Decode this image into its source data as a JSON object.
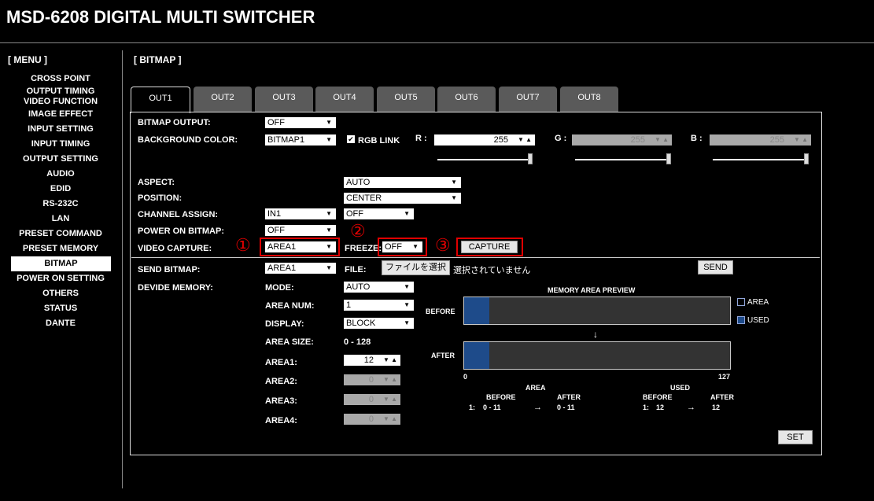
{
  "app_title": "MSD-6208 DIGITAL MULTI SWITCHER",
  "menu": {
    "heading": "[ MENU ]",
    "items": [
      "CROSS POINT",
      "OUTPUT TIMING",
      "VIDEO FUNCTION",
      "IMAGE EFFECT",
      "INPUT SETTING",
      "INPUT TIMING",
      "OUTPUT SETTING",
      "AUDIO",
      "EDID",
      "RS-232C",
      "LAN",
      "PRESET COMMAND",
      "PRESET MEMORY",
      "BITMAP",
      "POWER ON SETTING",
      "OTHERS",
      "STATUS",
      "DANTE"
    ],
    "active": "BITMAP"
  },
  "section_title": "[ BITMAP ]",
  "tabs": [
    "OUT1",
    "OUT2",
    "OUT3",
    "OUT4",
    "OUT5",
    "OUT6",
    "OUT7",
    "OUT8"
  ],
  "form": {
    "bitmap_output": {
      "label": "BITMAP OUTPUT:",
      "value": "OFF"
    },
    "background_color": {
      "label": "BACKGROUND COLOR:",
      "value": "BITMAP1"
    },
    "rgb_link": {
      "label": "RGB LINK",
      "checked": true
    },
    "r": {
      "label": "R :",
      "value": "255"
    },
    "g": {
      "label": "G :",
      "value": "255"
    },
    "b": {
      "label": "B :",
      "value": "255"
    },
    "aspect": {
      "label": "ASPECT:",
      "value": "AUTO"
    },
    "position": {
      "label": "POSITION:",
      "value": "CENTER"
    },
    "channel_assign": {
      "label": "CHANNEL ASSIGN:",
      "input": "IN1",
      "value": "OFF"
    },
    "power_on_bitmap": {
      "label": "POWER ON BITMAP:",
      "value": "OFF"
    },
    "video_capture": {
      "label": "VIDEO CAPTURE:",
      "value": "AREA1"
    },
    "freeze": {
      "label": "FREEZE:",
      "value": "OFF"
    },
    "capture_button": "CAPTURE",
    "send_bitmap": {
      "label": "SEND BITMAP:",
      "value": "AREA1"
    },
    "file": {
      "label": "FILE:",
      "button": "ファイルを選択",
      "status": "選択されていません"
    },
    "send_button": "SEND",
    "devide_memory": {
      "label": "DEVIDE MEMORY:"
    },
    "mode": {
      "label": "MODE:",
      "value": "AUTO"
    },
    "area_num": {
      "label": "AREA NUM:",
      "value": "1"
    },
    "display": {
      "label": "DISPLAY:",
      "value": "BLOCK"
    },
    "area_size": {
      "label": "AREA SIZE:",
      "value": "0 - 128"
    },
    "area1": {
      "label": "AREA1:",
      "value": "12"
    },
    "area2": {
      "label": "AREA2:",
      "value": "0"
    },
    "area3": {
      "label": "AREA3:",
      "value": "0"
    },
    "area4": {
      "label": "AREA4:",
      "value": "0"
    },
    "set_button": "SET"
  },
  "markers": [
    "①",
    "②",
    "③"
  ],
  "preview": {
    "title": "MEMORY AREA PREVIEW",
    "before_label": "BEFORE",
    "after_label": "AFTER",
    "arrow": "↓",
    "legend_area": "AREA",
    "legend_used": "USED",
    "scale_min": "0",
    "scale_max": "127",
    "used_fraction": 0.094,
    "area_heading": "AREA",
    "used_heading": "USED",
    "col_before": "BEFORE",
    "col_after": "AFTER",
    "area_row": {
      "index": "1:",
      "before": "0 - 11",
      "arrow": "→",
      "after": "0 - 11"
    },
    "used_row": {
      "index": "1:",
      "before": "12",
      "arrow": "→",
      "after": "12"
    }
  },
  "colors": {
    "used": "#1e4b8a",
    "highlight": "#e00000"
  }
}
